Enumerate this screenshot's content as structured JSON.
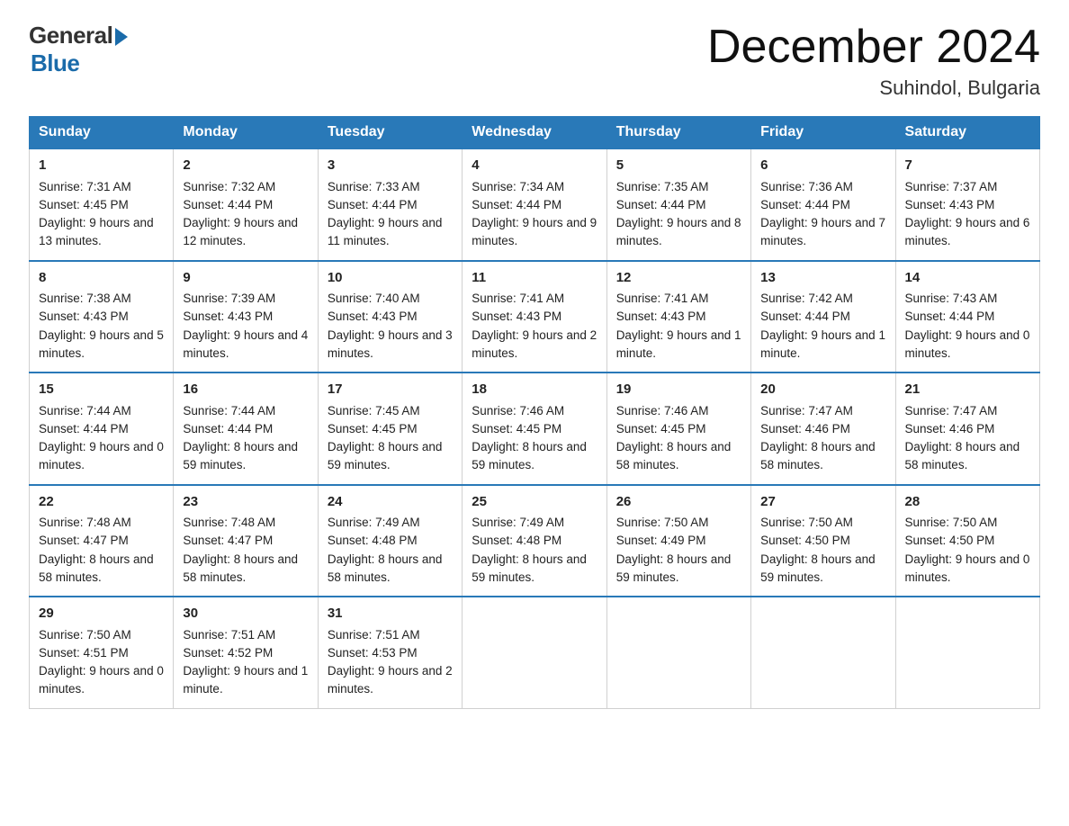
{
  "logo": {
    "text_general": "General",
    "text_blue": "Blue"
  },
  "title": "December 2024",
  "location": "Suhindol, Bulgaria",
  "days_of_week": [
    "Sunday",
    "Monday",
    "Tuesday",
    "Wednesday",
    "Thursday",
    "Friday",
    "Saturday"
  ],
  "weeks": [
    [
      {
        "day": "1",
        "sunrise": "7:31 AM",
        "sunset": "4:45 PM",
        "daylight": "9 hours and 13 minutes."
      },
      {
        "day": "2",
        "sunrise": "7:32 AM",
        "sunset": "4:44 PM",
        "daylight": "9 hours and 12 minutes."
      },
      {
        "day": "3",
        "sunrise": "7:33 AM",
        "sunset": "4:44 PM",
        "daylight": "9 hours and 11 minutes."
      },
      {
        "day": "4",
        "sunrise": "7:34 AM",
        "sunset": "4:44 PM",
        "daylight": "9 hours and 9 minutes."
      },
      {
        "day": "5",
        "sunrise": "7:35 AM",
        "sunset": "4:44 PM",
        "daylight": "9 hours and 8 minutes."
      },
      {
        "day": "6",
        "sunrise": "7:36 AM",
        "sunset": "4:44 PM",
        "daylight": "9 hours and 7 minutes."
      },
      {
        "day": "7",
        "sunrise": "7:37 AM",
        "sunset": "4:43 PM",
        "daylight": "9 hours and 6 minutes."
      }
    ],
    [
      {
        "day": "8",
        "sunrise": "7:38 AM",
        "sunset": "4:43 PM",
        "daylight": "9 hours and 5 minutes."
      },
      {
        "day": "9",
        "sunrise": "7:39 AM",
        "sunset": "4:43 PM",
        "daylight": "9 hours and 4 minutes."
      },
      {
        "day": "10",
        "sunrise": "7:40 AM",
        "sunset": "4:43 PM",
        "daylight": "9 hours and 3 minutes."
      },
      {
        "day": "11",
        "sunrise": "7:41 AM",
        "sunset": "4:43 PM",
        "daylight": "9 hours and 2 minutes."
      },
      {
        "day": "12",
        "sunrise": "7:41 AM",
        "sunset": "4:43 PM",
        "daylight": "9 hours and 1 minute."
      },
      {
        "day": "13",
        "sunrise": "7:42 AM",
        "sunset": "4:44 PM",
        "daylight": "9 hours and 1 minute."
      },
      {
        "day": "14",
        "sunrise": "7:43 AM",
        "sunset": "4:44 PM",
        "daylight": "9 hours and 0 minutes."
      }
    ],
    [
      {
        "day": "15",
        "sunrise": "7:44 AM",
        "sunset": "4:44 PM",
        "daylight": "9 hours and 0 minutes."
      },
      {
        "day": "16",
        "sunrise": "7:44 AM",
        "sunset": "4:44 PM",
        "daylight": "8 hours and 59 minutes."
      },
      {
        "day": "17",
        "sunrise": "7:45 AM",
        "sunset": "4:45 PM",
        "daylight": "8 hours and 59 minutes."
      },
      {
        "day": "18",
        "sunrise": "7:46 AM",
        "sunset": "4:45 PM",
        "daylight": "8 hours and 59 minutes."
      },
      {
        "day": "19",
        "sunrise": "7:46 AM",
        "sunset": "4:45 PM",
        "daylight": "8 hours and 58 minutes."
      },
      {
        "day": "20",
        "sunrise": "7:47 AM",
        "sunset": "4:46 PM",
        "daylight": "8 hours and 58 minutes."
      },
      {
        "day": "21",
        "sunrise": "7:47 AM",
        "sunset": "4:46 PM",
        "daylight": "8 hours and 58 minutes."
      }
    ],
    [
      {
        "day": "22",
        "sunrise": "7:48 AM",
        "sunset": "4:47 PM",
        "daylight": "8 hours and 58 minutes."
      },
      {
        "day": "23",
        "sunrise": "7:48 AM",
        "sunset": "4:47 PM",
        "daylight": "8 hours and 58 minutes."
      },
      {
        "day": "24",
        "sunrise": "7:49 AM",
        "sunset": "4:48 PM",
        "daylight": "8 hours and 58 minutes."
      },
      {
        "day": "25",
        "sunrise": "7:49 AM",
        "sunset": "4:48 PM",
        "daylight": "8 hours and 59 minutes."
      },
      {
        "day": "26",
        "sunrise": "7:50 AM",
        "sunset": "4:49 PM",
        "daylight": "8 hours and 59 minutes."
      },
      {
        "day": "27",
        "sunrise": "7:50 AM",
        "sunset": "4:50 PM",
        "daylight": "8 hours and 59 minutes."
      },
      {
        "day": "28",
        "sunrise": "7:50 AM",
        "sunset": "4:50 PM",
        "daylight": "9 hours and 0 minutes."
      }
    ],
    [
      {
        "day": "29",
        "sunrise": "7:50 AM",
        "sunset": "4:51 PM",
        "daylight": "9 hours and 0 minutes."
      },
      {
        "day": "30",
        "sunrise": "7:51 AM",
        "sunset": "4:52 PM",
        "daylight": "9 hours and 1 minute."
      },
      {
        "day": "31",
        "sunrise": "7:51 AM",
        "sunset": "4:53 PM",
        "daylight": "9 hours and 2 minutes."
      },
      null,
      null,
      null,
      null
    ]
  ],
  "labels": {
    "sunrise": "Sunrise:",
    "sunset": "Sunset:",
    "daylight": "Daylight:"
  }
}
